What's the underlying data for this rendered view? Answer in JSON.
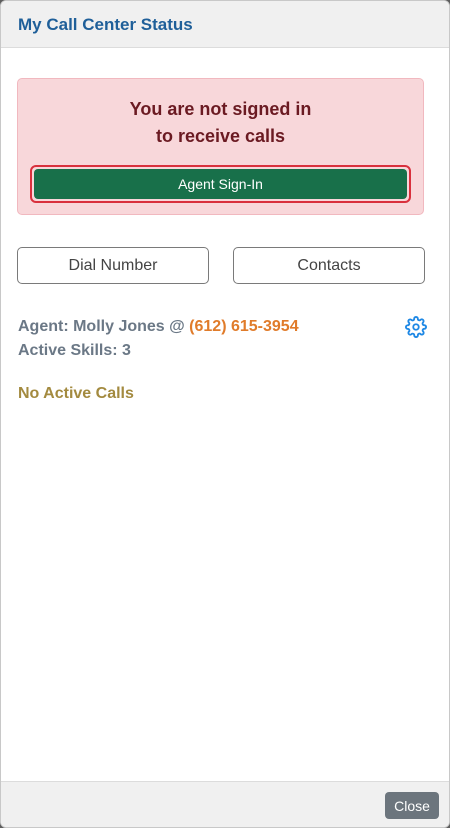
{
  "header": {
    "title": "My Call Center Status"
  },
  "alert": {
    "line1": "You are not signed in",
    "line2": "to receive calls",
    "signin_label": "Agent Sign-In"
  },
  "actions": {
    "dial_label": "Dial Number",
    "contacts_label": "Contacts"
  },
  "agent": {
    "prefix": "Agent: Molly Jones @ ",
    "phone": "(612) 615-3954",
    "skills": "Active Skills: 3",
    "settings_icon": "gear-icon"
  },
  "calls": {
    "status": "No Active Calls"
  },
  "footer": {
    "close_label": "Close"
  },
  "colors": {
    "title": "#1f5f99",
    "alert_bg": "#f8d7da",
    "alert_text": "#6b1a22",
    "signin_bg": "#18704a",
    "signin_border": "#d9303d",
    "phone": "#e07b2a",
    "gear": "#1e88e5",
    "no_calls": "#a38a3f",
    "close_bg": "#6c757d"
  }
}
